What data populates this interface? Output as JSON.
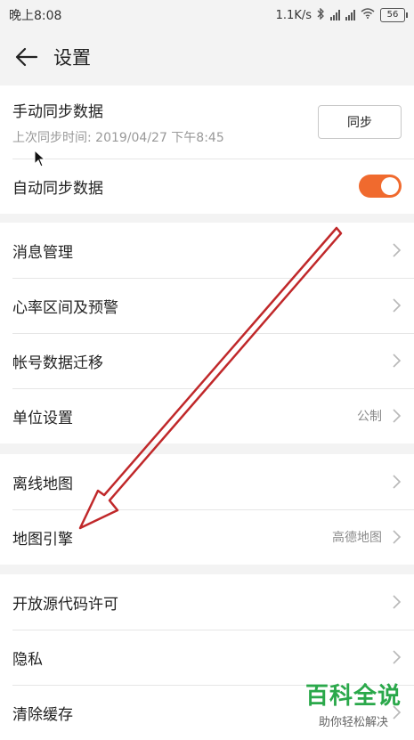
{
  "status_bar": {
    "time": "晚上8:08",
    "net_speed": "1.1K/s",
    "battery": "56"
  },
  "app_bar": {
    "title": "设置"
  },
  "sync_card": {
    "manual_sync_label": "手动同步数据",
    "last_sync_text": "上次同步时间: 2019/04/27 下午8:45",
    "sync_button": "同步",
    "auto_sync_label": "自动同步数据",
    "auto_sync_on": true,
    "accent_color": "#f06a2e"
  },
  "group1": [
    {
      "label": "消息管理",
      "value": ""
    },
    {
      "label": "心率区间及预警",
      "value": ""
    },
    {
      "label": "帐号数据迁移",
      "value": ""
    },
    {
      "label": "单位设置",
      "value": "公制"
    }
  ],
  "group2": [
    {
      "label": "离线地图",
      "value": ""
    },
    {
      "label": "地图引擎",
      "value": "高德地图"
    }
  ],
  "group3": [
    {
      "label": "开放源代码许可",
      "value": ""
    },
    {
      "label": "隐私",
      "value": ""
    },
    {
      "label": "清除缓存",
      "value": ""
    }
  ],
  "watermark": {
    "title": "百科全说",
    "subtitle": "助你轻松解决"
  },
  "annotation": {
    "arrow_color": "#c0282a"
  }
}
